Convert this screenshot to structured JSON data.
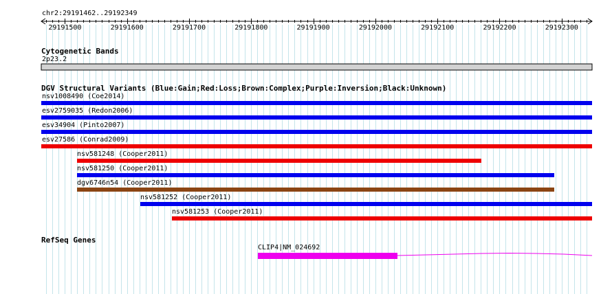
{
  "ruler": {
    "range_label": "chr2:29191462..29192349",
    "start": 29191462,
    "end": 29192349,
    "tick_labels": [
      "29191500",
      "29191600",
      "29191700",
      "29191800",
      "29191900",
      "29192000",
      "29192100",
      "29192200",
      "29192300"
    ]
  },
  "cytobands": {
    "title": "Cytogenetic Bands",
    "band": "2p23.2"
  },
  "dgv": {
    "title": "DGV Structural Variants (Blue:Gain;Red:Loss;Brown:Complex;Purple:Inversion;Black:Unknown)",
    "variants": [
      {
        "label": "nsv1008490 (Coe2014)",
        "type": "gain",
        "color": "#0000ee"
      },
      {
        "label": "esv2759035 (Redon2006)",
        "type": "gain",
        "color": "#0000ee"
      },
      {
        "label": "esv34904 (Pinto2007)",
        "type": "gain",
        "color": "#0000ee"
      },
      {
        "label": "esv27586 (Conrad2009)",
        "type": "loss",
        "color": "#ee0000"
      },
      {
        "label": "nsv581248 (Cooper2011)",
        "type": "loss",
        "color": "#ee0000"
      },
      {
        "label": "nsv581250 (Cooper2011)",
        "type": "gain",
        "color": "#0000ee"
      },
      {
        "label": "dgv6746n54 (Cooper2011)",
        "type": "complex",
        "color": "#8b4513"
      },
      {
        "label": "nsv581252 (Cooper2011)",
        "type": "gain",
        "color": "#0000ee"
      },
      {
        "label": "nsv581253 (Cooper2011)",
        "type": "loss",
        "color": "#ee0000"
      }
    ]
  },
  "refseq": {
    "title": "RefSeq Genes",
    "gene_label": "CLIP4|NM_024692",
    "color": "#ee00ee"
  }
}
